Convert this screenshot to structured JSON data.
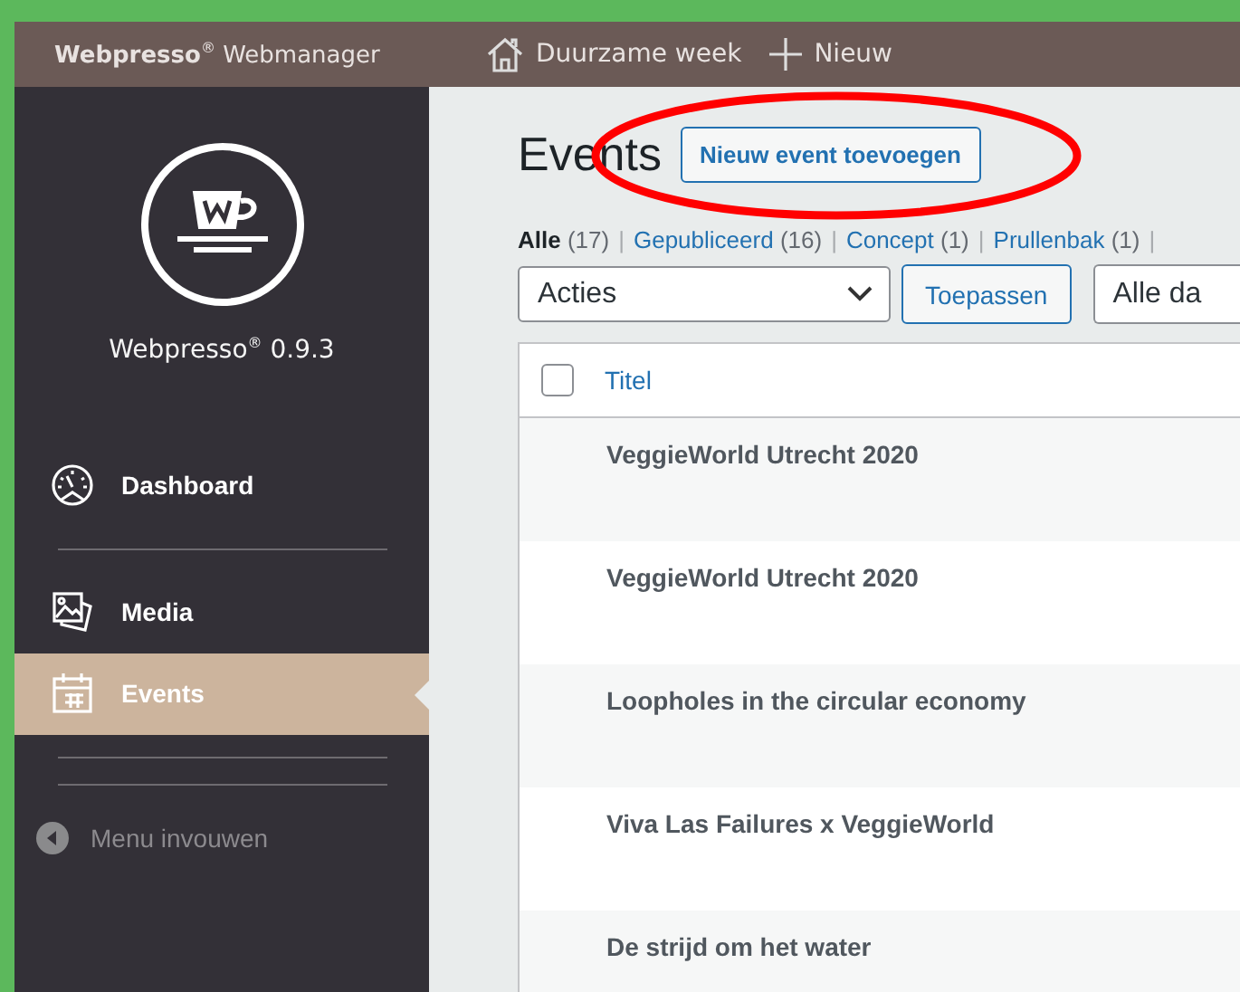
{
  "topbar": {
    "brand": "**Webpresso**$^{®}$ Webmanager",
    "items": [
      {
        "kind": "home",
        "label": "Duurzame week"
      },
      {
        "kind": "plus",
        "label": "Nieuw"
      }
    ]
  },
  "sidebar": {
    "version": "Webpresso$^{®}$ 0.9.3",
    "items": [
      {
        "kind": "dashboard",
        "label": "Dashboard",
        "selected": false
      },
      {
        "kind": "media",
        "label": "Media",
        "selected": false
      },
      {
        "kind": "calendar",
        "label": "Events",
        "selected": true
      }
    ],
    "collapse": "Menu invouwen"
  },
  "page": {
    "title": "Events",
    "add_button": "Nieuw event toevoegen"
  },
  "filters": [
    {
      "label": "Alle",
      "count": "(17)",
      "selected": true,
      "separator": "|"
    },
    {
      "label": "Gepubliceerd",
      "count": "(16)",
      "selected": false,
      "separator": "|"
    },
    {
      "label": "Concept",
      "count": "(1)",
      "selected": false,
      "separator": "|"
    },
    {
      "label": "Prullenbak",
      "count": "(1)",
      "selected": false,
      "separator": "|"
    }
  ],
  "bulk_actions": {
    "select": "Acties",
    "button": "Toepassen",
    "date_filter": "Alle da"
  },
  "table": {
    "header_checked": false,
    "columns": [
      {
        "label": "Titel"
      }
    ],
    "rows": [
      {
        "title": "VeggieWorld Utrecht 2020"
      },
      {
        "title": "VeggieWorld Utrecht 2020"
      },
      {
        "title": "Loopholes in the circular economy"
      },
      {
        "title": "Viva Las Failures x VeggieWorld"
      },
      {
        "title": "De strijd om het water"
      }
    ]
  }
}
